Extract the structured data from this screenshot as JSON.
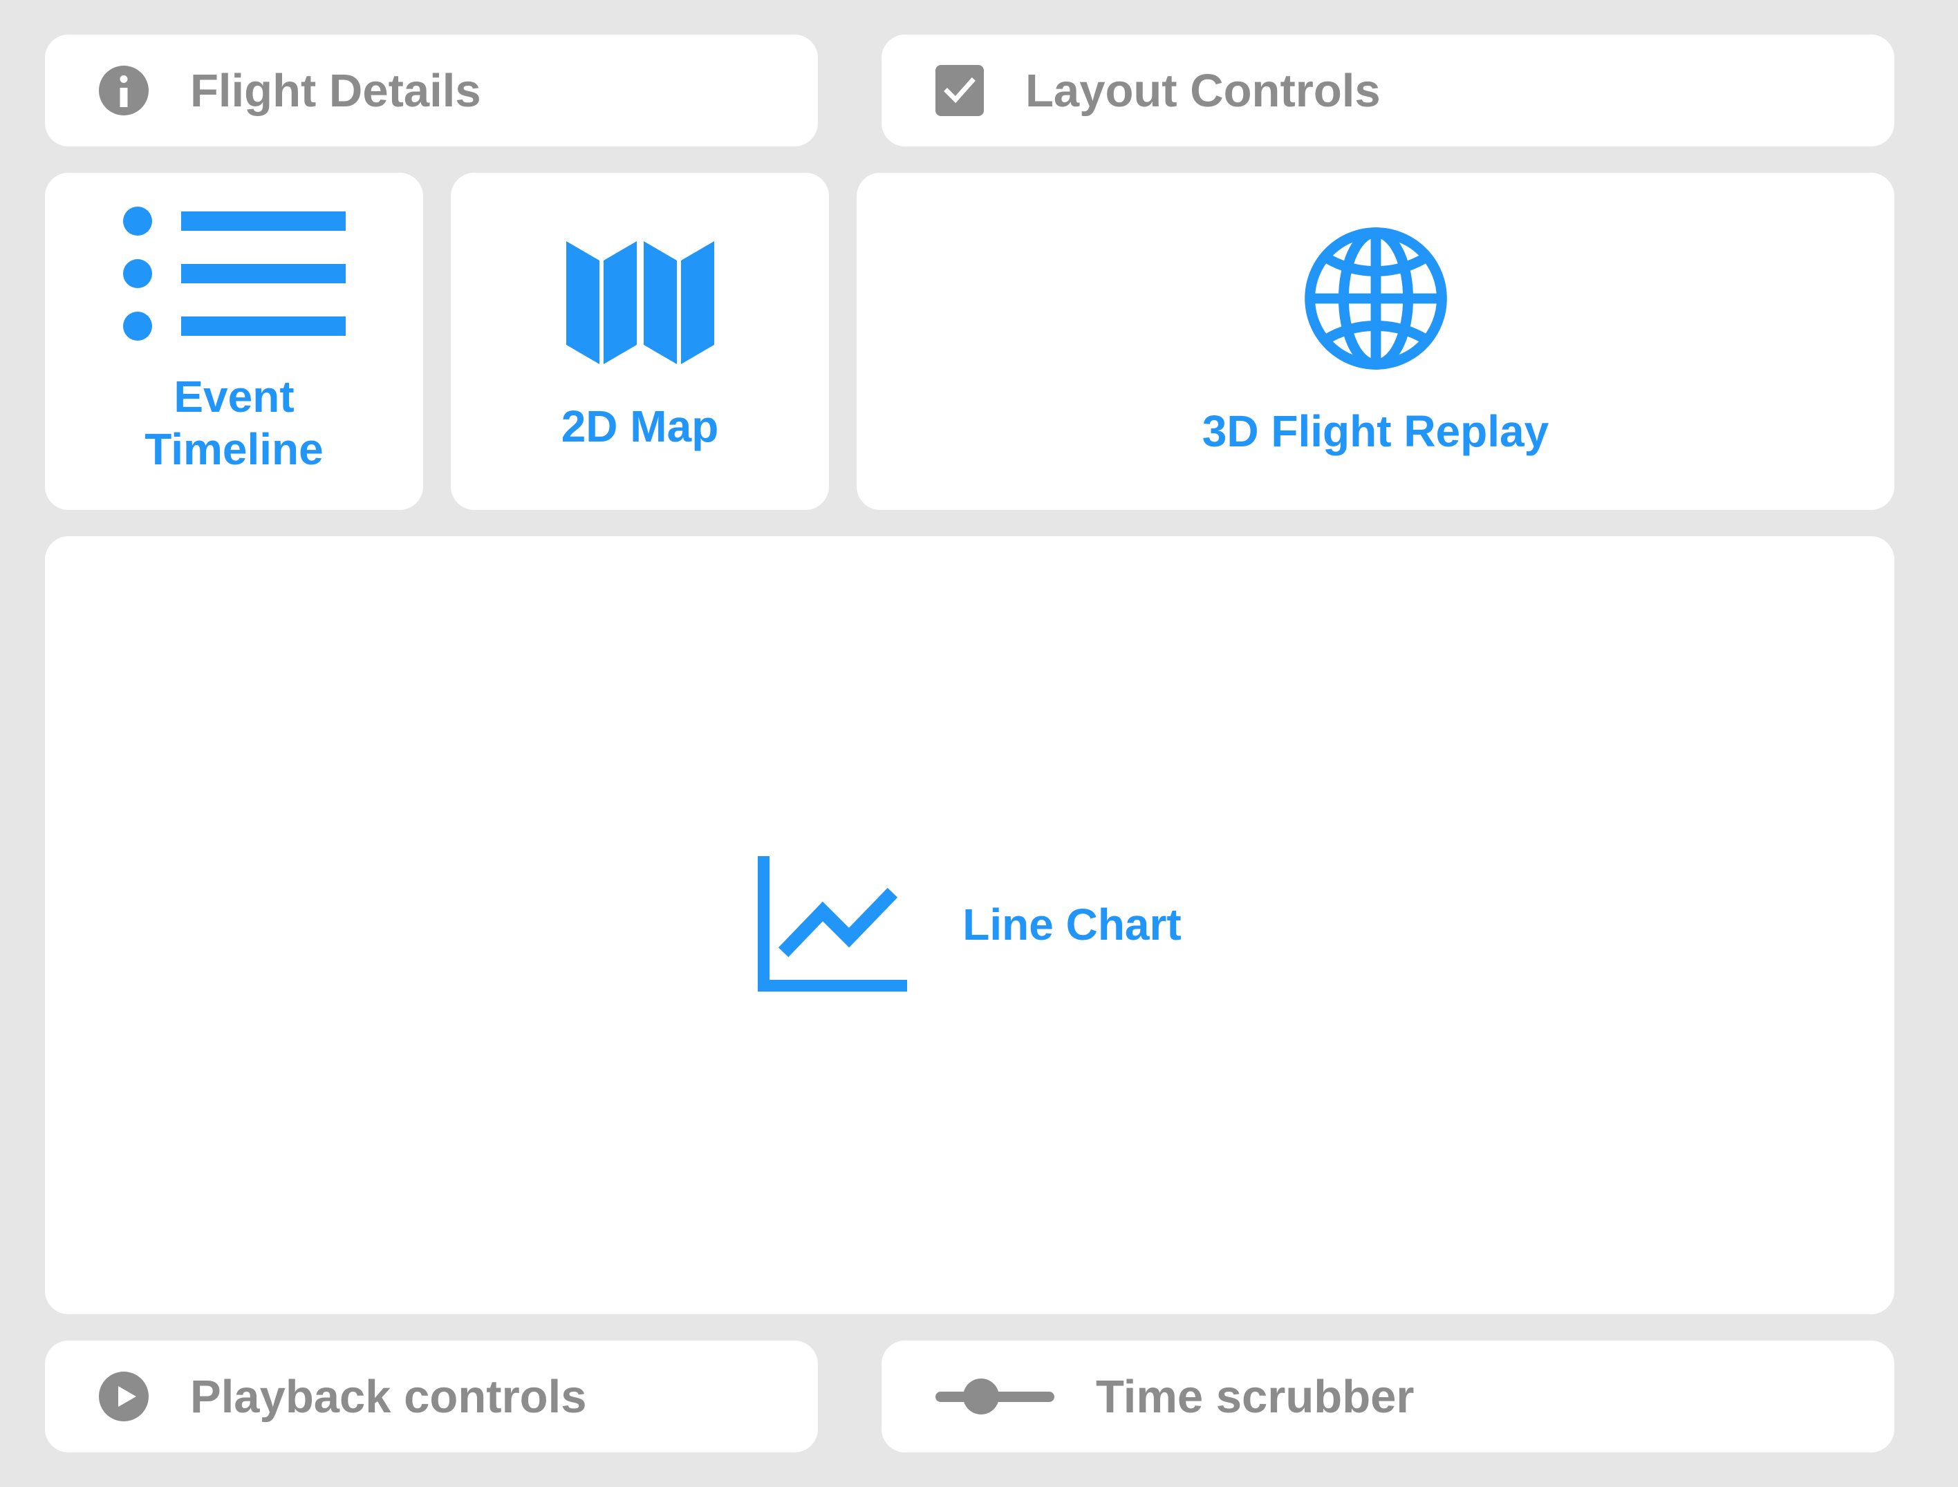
{
  "theme": {
    "background": "#e6e6e6",
    "card_background": "#ffffff",
    "accent_blue": "#2196f8",
    "muted_gray": "#8c8c8c"
  },
  "top_bars": [
    {
      "id": "flight-details",
      "icon": "info-icon",
      "label": "Flight Details"
    },
    {
      "id": "layout-controls",
      "icon": "checkbox-checked-icon",
      "label": "Layout Controls"
    }
  ],
  "panels": [
    {
      "id": "event-timeline",
      "icon": "list-icon",
      "label": "Event\nTimeline"
    },
    {
      "id": "2d-map",
      "icon": "map-icon",
      "label": "2D Map"
    },
    {
      "id": "3d-flight-replay",
      "icon": "globe-icon",
      "label": "3D Flight Replay"
    }
  ],
  "chart_panel": {
    "id": "line-chart",
    "icon": "line-chart-icon",
    "label": "Line Chart"
  },
  "bottom_bars": [
    {
      "id": "playback-controls",
      "icon": "play-circle-icon",
      "label": "Playback controls"
    },
    {
      "id": "time-scrubber",
      "icon": "slider-icon",
      "label": "Time scrubber"
    }
  ]
}
